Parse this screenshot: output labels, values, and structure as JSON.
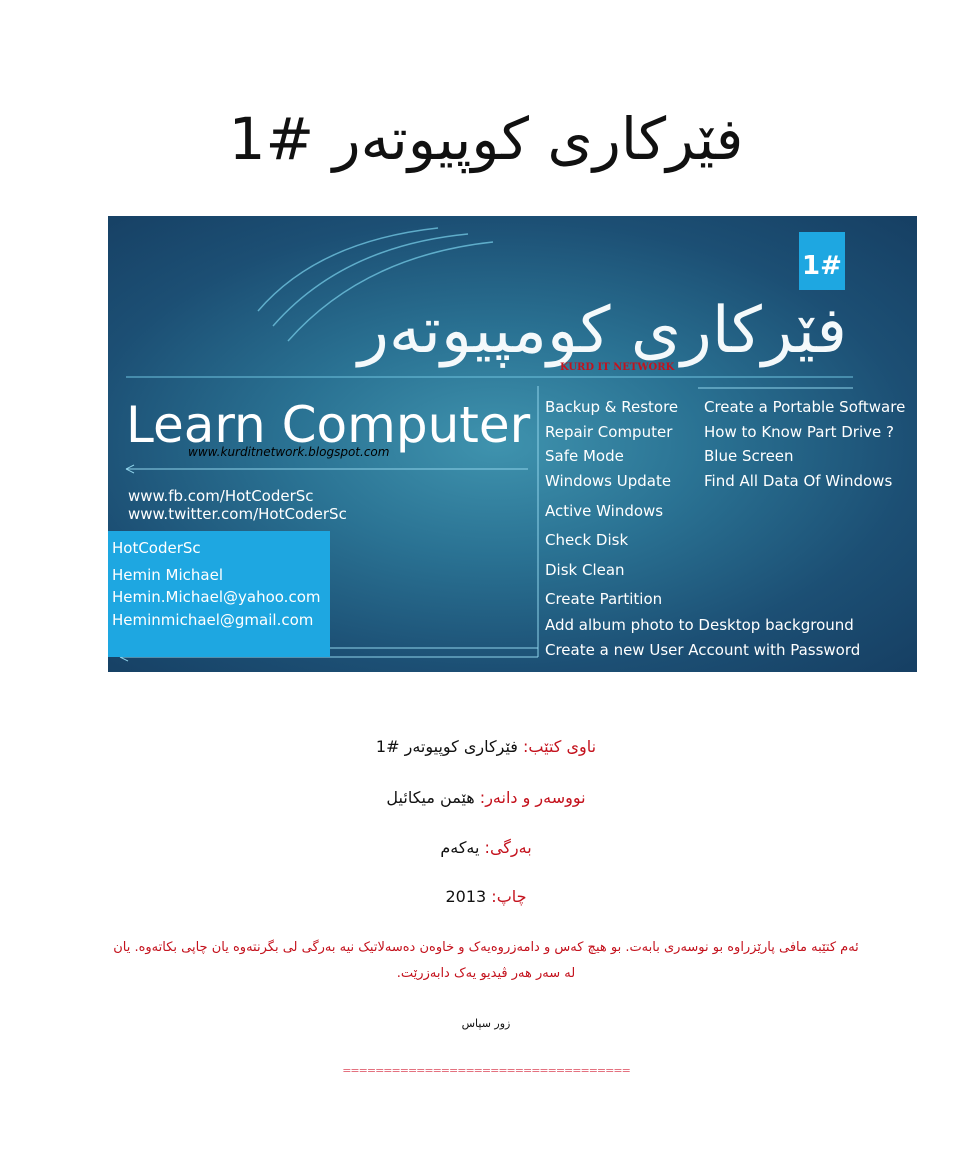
{
  "page_title": "فێرکاری کوپیوتەر #1",
  "cover": {
    "badge": "1#",
    "title": "فێرکاری کومپیوتەر",
    "watermark": "KURD IT NETWORK",
    "learn": "Learn Computer",
    "site": "www.kurditnetwork.blogspot.com",
    "social": [
      "www.fb.com/HotCoderSc",
      "www.twitter.com/HotCoderSc"
    ],
    "contact": [
      "HotCoderSc",
      "Hemin Michael",
      "Hemin.Michael@yahoo.com",
      "Heminmichael@gmail.com"
    ],
    "topics_left": [
      "Backup & Restore",
      "Repair Computer",
      "Safe Mode",
      "Windows Update",
      "Active Windows",
      "Check Disk",
      "Disk Clean",
      "Create Partition",
      "Add album photo to Desktop background",
      "Create a new User Account with Password"
    ],
    "topics_right": [
      "Create a Portable Software",
      "How to Know Part Drive ?",
      "Blue Screen",
      "Find All Data Of Windows"
    ]
  },
  "meta": {
    "book_label": "ناوی کتێب:",
    "book_value": " فێرکاری کوپیوتەر #1",
    "author_label": "نووسەر و دانەر:",
    "author_value": " هێمن میکائیل",
    "edition_label": "بەرگی:",
    "edition_value": " یەکەم",
    "print_label": "چاپ:",
    "print_value": " 2013"
  },
  "note_line1": "ئەم کتێبە مافی پارێزراوە بو نوسەری بابەت. بو هیچ کەس و دامەزروەیەک و خاوەن دەسەلاتیک نیە بەرگی لی بگرنتەوە یان چاپی بکاتەوە. یان",
  "note_line2": "لە سەر هەر ڤیدیو یەک دابەزرێت.",
  "thanks": "زور سپاس",
  "rule": "==================================="
}
